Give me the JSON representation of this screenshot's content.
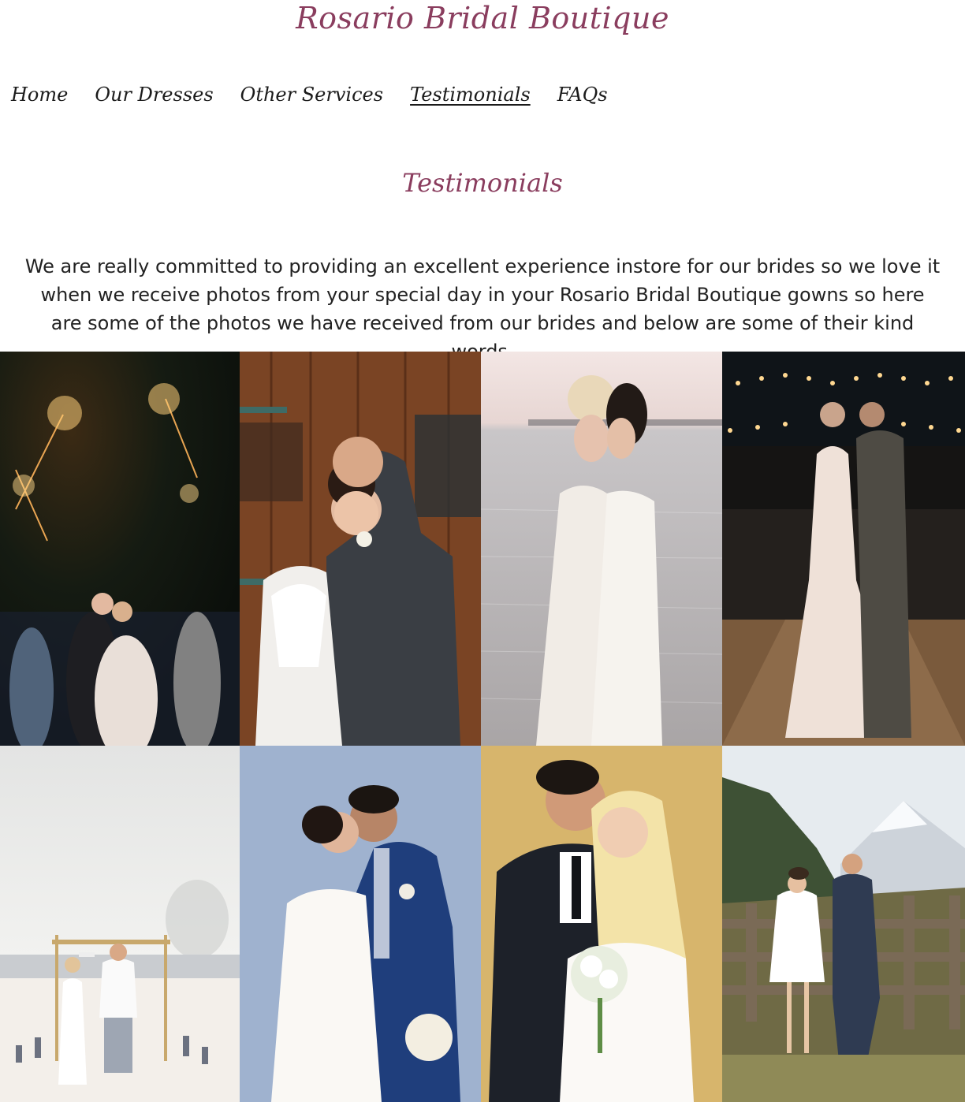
{
  "site": {
    "brand": "Rosario Bridal Boutique"
  },
  "nav": {
    "items": [
      {
        "label": "Home",
        "active": false
      },
      {
        "label": "Our Dresses",
        "active": false
      },
      {
        "label": "Other Services",
        "active": false
      },
      {
        "label": "Testimonials",
        "active": true
      },
      {
        "label": "FAQs",
        "active": false
      }
    ]
  },
  "page": {
    "heading": "Testimonials",
    "intro": "We are really committed to providing an excellent experience instore for our brides so we love it when we receive photos from your special day in your Rosario Bridal Boutique gowns so here are some of the photos we have received from our brides and below are some of their kind words."
  },
  "colors": {
    "brand": "#8a3d5e",
    "text": "#222222",
    "nav_text": "#1b1b1b",
    "background": "#ffffff"
  },
  "gallery": {
    "photos": [
      {
        "name": "photo-sparkler-kiss",
        "scene": "night-sparklers"
      },
      {
        "name": "photo-wooden-door-couple",
        "scene": "wooden-door"
      },
      {
        "name": "photo-lakeside-brides",
        "scene": "lakeside"
      },
      {
        "name": "photo-string-lights-tent",
        "scene": "tent-lights"
      },
      {
        "name": "photo-beach-arch",
        "scene": "beach"
      },
      {
        "name": "photo-blue-backdrop-couple",
        "scene": "blue-studio"
      },
      {
        "name": "photo-gold-backdrop-couple",
        "scene": "gold-studio"
      },
      {
        "name": "photo-mountain-fence",
        "scene": "mountain"
      }
    ]
  }
}
